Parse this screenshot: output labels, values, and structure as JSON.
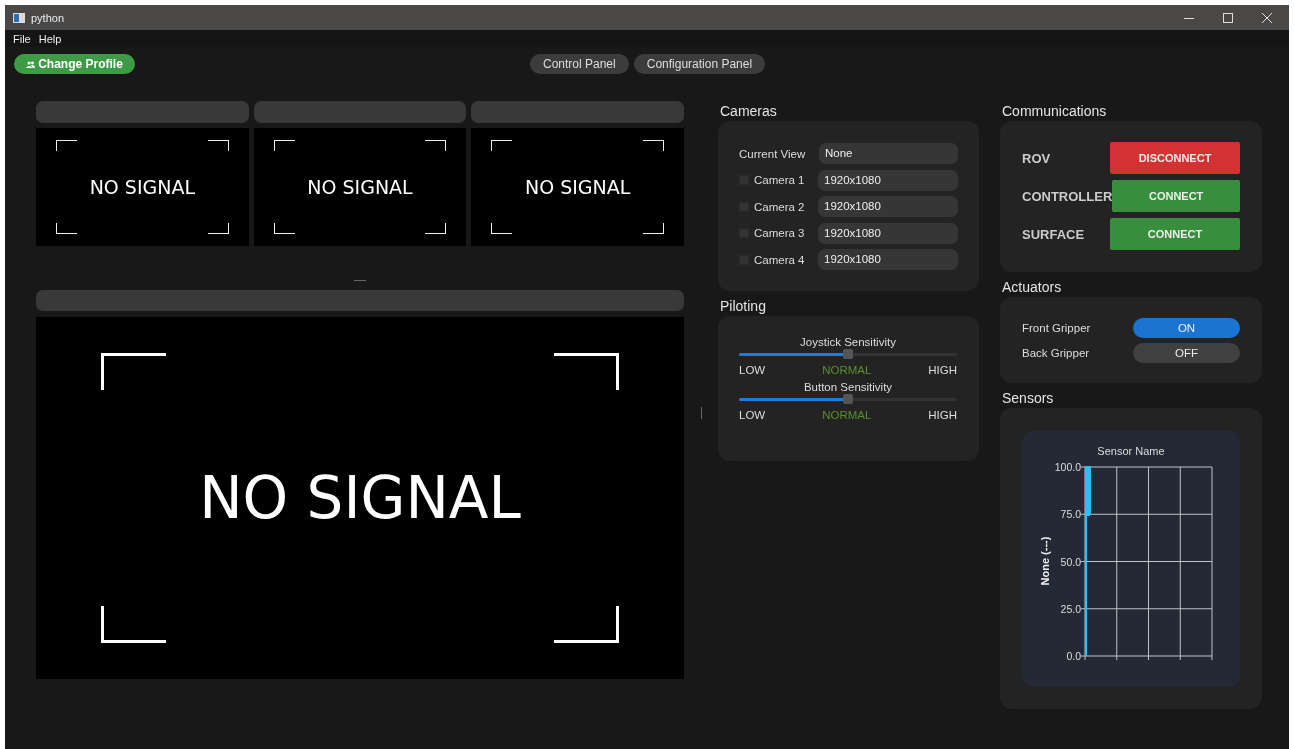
{
  "window": {
    "title": "python"
  },
  "menu": [
    "File",
    "Help"
  ],
  "profile_button": {
    "label": "Change Profile"
  },
  "panel_buttons": [
    "Control Panel",
    "Configuration Panel"
  ],
  "feeds": [
    {
      "text": "NO SIGNAL"
    },
    {
      "text": "NO SIGNAL"
    },
    {
      "text": "NO SIGNAL"
    }
  ],
  "main_feed": {
    "text": "NO SIGNAL"
  },
  "cameras": {
    "title": "Cameras",
    "current_view": {
      "label": "Current View",
      "value": "None"
    },
    "items": [
      {
        "label": "Camera 1",
        "checked": false,
        "value": "1920x1080"
      },
      {
        "label": "Camera 2",
        "checked": false,
        "value": "1920x1080"
      },
      {
        "label": "Camera 3",
        "checked": false,
        "value": "1920x1080"
      },
      {
        "label": "Camera 4",
        "checked": false,
        "value": "1920x1080"
      }
    ]
  },
  "piloting": {
    "title": "Piloting",
    "sliders": [
      {
        "label": "Joystick Sensitivity",
        "level": 0.5,
        "low": "LOW",
        "mid": "NORMAL",
        "high": "HIGH"
      },
      {
        "label": "Button Sensitivity",
        "level": 0.5,
        "low": "LOW",
        "mid": "NORMAL",
        "high": "HIGH"
      }
    ]
  },
  "communications": {
    "title": "Communications",
    "items": [
      {
        "label": "ROV",
        "connected": true,
        "action": "DISCONNECT"
      },
      {
        "label": "CONTROLLER",
        "connected": false,
        "action": "CONNECT"
      },
      {
        "label": "SURFACE",
        "connected": false,
        "action": "CONNECT"
      }
    ]
  },
  "actuators": {
    "title": "Actuators",
    "items": [
      {
        "label": "Front Gripper",
        "on": true,
        "state_text": "ON"
      },
      {
        "label": "Back Gripper",
        "on": false,
        "state_text": "OFF"
      }
    ]
  },
  "sensors": {
    "title": "Sensors",
    "plot": {
      "title": "Sensor Name",
      "ylabel": "None (---)",
      "yticks": [
        "100.0",
        "75.0",
        "50.0",
        "25.0",
        "0.0"
      ]
    }
  }
}
